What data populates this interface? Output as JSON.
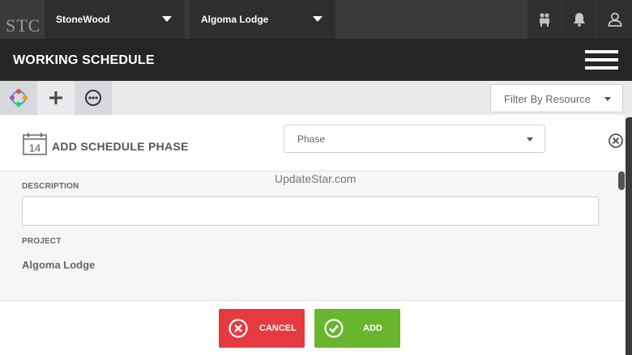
{
  "header": {
    "logo_text": "STC",
    "company_select": "StoneWood",
    "project_select": "Algoma Lodge",
    "icons": [
      "people-icon",
      "bell-icon",
      "user-icon"
    ]
  },
  "titlebar": {
    "title": "WORKING SCHEDULE"
  },
  "toolbar": {
    "tools": [
      "color-wheel-icon",
      "plus-icon",
      "options-icon"
    ],
    "filter_label": "Filter By Resource"
  },
  "modal": {
    "calendar_day": "14",
    "title": "ADD SCHEDULE PHASE",
    "type_select": "Phase",
    "watermark": "UpdateStar.com",
    "description_label": "DESCRIPTION",
    "description_value": "",
    "project_label": "PROJECT",
    "project_value": "Algoma Lodge"
  },
  "footer": {
    "cancel_label": "CANCEL",
    "add_label": "ADD"
  },
  "colors": {
    "topbar": "#3a3a3a",
    "titlebar": "#262626",
    "cancel": "#e53a3f",
    "add": "#69b52e"
  }
}
